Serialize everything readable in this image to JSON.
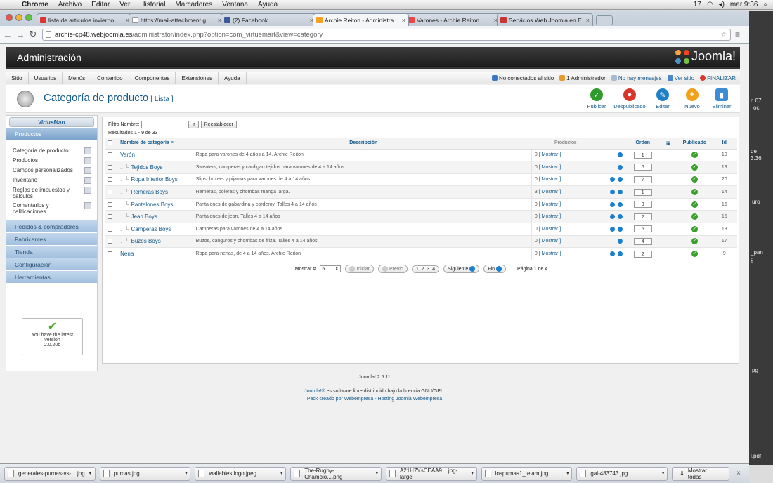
{
  "macbar": {
    "apple": "",
    "menus": [
      "Chrome",
      "Archivo",
      "Editar",
      "Ver",
      "Historial",
      "Marcadores",
      "Ventana",
      "Ayuda"
    ],
    "status_num": "17",
    "clock": "mar 9:36"
  },
  "tabs": [
    {
      "title": "lista de articulos invierno",
      "fav": "#d33"
    },
    {
      "title": "https://mail-attachment.g",
      "fav": "#fff"
    },
    {
      "title": "(2) Facebook",
      "fav": "#3b5998"
    },
    {
      "title": "Archie Reiton - Administra",
      "fav": "#f6a21e",
      "active": true
    },
    {
      "title": "Varones - Archie Reiton",
      "fav": "#e44"
    },
    {
      "title": "Servicios Web Joomla en E",
      "fav": "#c33"
    }
  ],
  "url": {
    "host": "archie-cp48.webjoomla.es",
    "path": "/administrator/index.php?option=com_virtuemart&view=category"
  },
  "admin": {
    "title": "Administración",
    "logo": "Joomla!"
  },
  "menubar": {
    "items": [
      "Sitio",
      "Usuarios",
      "Menús",
      "Contenido",
      "Componentes",
      "Extensiones",
      "Ayuda"
    ],
    "status": [
      "No conectados al sitio",
      "1 Administrador",
      "No hay mensajes",
      "Ver sitio",
      "FINALIZAR"
    ]
  },
  "page": {
    "title": "Categoría de producto",
    "subtitle": "[ Lista ]"
  },
  "actions": [
    {
      "label": "Publicar",
      "color": "#2f9b2a",
      "glyph": "✓"
    },
    {
      "label": "Despublicado",
      "color": "#d9362b",
      "glyph": "●"
    },
    {
      "label": "Editar",
      "color": "#1e80c8",
      "glyph": "✎"
    },
    {
      "label": "Nuevo",
      "color": "#f3a01b",
      "glyph": "+"
    },
    {
      "label": "Eliminar",
      "color": "#3c8dd6",
      "glyph": "🗑"
    }
  ],
  "sidebar": {
    "logo": "VirtueMart",
    "section": "Productos",
    "items": [
      "Categoría de producto",
      "Productos",
      "Campos personalizados",
      "Inventario",
      "Reglas de impuestos y cálculos",
      "Comentarios y calificaciones"
    ],
    "links": [
      "Pedidos & compradores",
      "Fabricantes",
      "Tienda",
      "Configuración",
      "Herramientas"
    ],
    "latest": {
      "line1": "You have the latest",
      "line2": "version",
      "line3": "2.0.20b"
    }
  },
  "filter": {
    "label": "Filtro Nombre:",
    "value": "",
    "go": "Ir",
    "reset": "Reestablecer",
    "results": "Resultados 1 - 9 de 33"
  },
  "table": {
    "headers": {
      "name": "Nombre de categoría",
      "desc": "Descripción",
      "prod": "Productos",
      "order": "Orden",
      "pub": "Publicado",
      "id": "Id"
    },
    "rows": [
      {
        "name": "Varón",
        "level": 0,
        "desc": "Ropa para varones de 4 años a 14. Archie Reiton",
        "count": "0",
        "link": "[ Mostrar ]",
        "order": "1",
        "up": false,
        "down": true,
        "id": "10"
      },
      {
        "name": "Tejidos Boys",
        "level": 1,
        "desc": "Sweaters, camperas y cardigan tejidos para varones de 4 a 14 años",
        "count": "0",
        "link": "[ Mostrar ]",
        "order": "6",
        "up": false,
        "down": true,
        "id": "19"
      },
      {
        "name": "Ropa Interior Boys",
        "level": 1,
        "desc": "Slips, boxers y pijamas para varones de 4 a 14 años",
        "count": "0",
        "link": "[ Mostrar ]",
        "order": "7",
        "up": true,
        "down": true,
        "id": "20"
      },
      {
        "name": "Remeras Boys",
        "level": 1,
        "desc": "Remeras, poleras y chombas manga larga.",
        "count": "3",
        "link": "[ Mostrar ]",
        "order": "1",
        "up": true,
        "down": true,
        "id": "14"
      },
      {
        "name": "Pantalones Boys",
        "level": 1,
        "desc": "Pantalones de gabardina y corderoy. Talles 4 a 14 años",
        "count": "0",
        "link": "[ Mostrar ]",
        "order": "3",
        "up": true,
        "down": true,
        "id": "16"
      },
      {
        "name": "Jean Boys",
        "level": 1,
        "desc": "Pantalones de jean. Talles 4 a 14 años",
        "count": "0",
        "link": "[ Mostrar ]",
        "order": "2",
        "up": true,
        "down": true,
        "id": "15"
      },
      {
        "name": "Camperas Boys",
        "level": 1,
        "desc": "Camperas para varones de 4 a 14 años",
        "count": "0",
        "link": "[ Mostrar ]",
        "order": "5",
        "up": true,
        "down": true,
        "id": "18"
      },
      {
        "name": "Buzos Boys",
        "level": 1,
        "desc": "Buzos, canguros y chombas de friza. Talles 4 a 14 años",
        "count": "0",
        "link": "[ Mostrar ]",
        "order": "4",
        "up": true,
        "down": false,
        "id": "17"
      },
      {
        "name": "Nena",
        "level": 0,
        "desc": "Ropa para nenas, de 4 a 14 años. Archie Reiton",
        "count": "0",
        "link": "[ Mostrar ]",
        "order": "2",
        "up": true,
        "down": true,
        "id": "9"
      }
    ]
  },
  "pager": {
    "show_label": "Mostrar #",
    "show_value": "5",
    "start": "Iniciar",
    "prev": "Previo",
    "pages": "1  2  3  4",
    "next": "Siguiente",
    "end": "Fin",
    "info": "Página 1 de 4"
  },
  "footer": {
    "version": "Joomla! 2.5.11",
    "license_link": "Joomla!®",
    "license_text": " es software libre distribuido bajo la licencia GNU/GPL.",
    "credit": "Pack creado por Webempresa - Hosting Joomla Webempresa"
  },
  "downloads": [
    "generales-pumas-vs-....jpg",
    "pumas.jpg",
    "wallabies logo.jpeg",
    "The-Rugby-Champio....png",
    "A21H7YsCEAA9....jpg-large",
    "lospumas1_telam.jpg",
    "gal-483743.jpg"
  ],
  "download_all": "Mostrar todas",
  "desktop": {
    "t1": "n 07",
    "t2": "oc",
    "t3": "de",
    "t4": "3.36",
    "t5": "uro",
    "t6": "_pan",
    "t7": "g",
    "t8": "pg",
    "t9": "l.pdf"
  }
}
